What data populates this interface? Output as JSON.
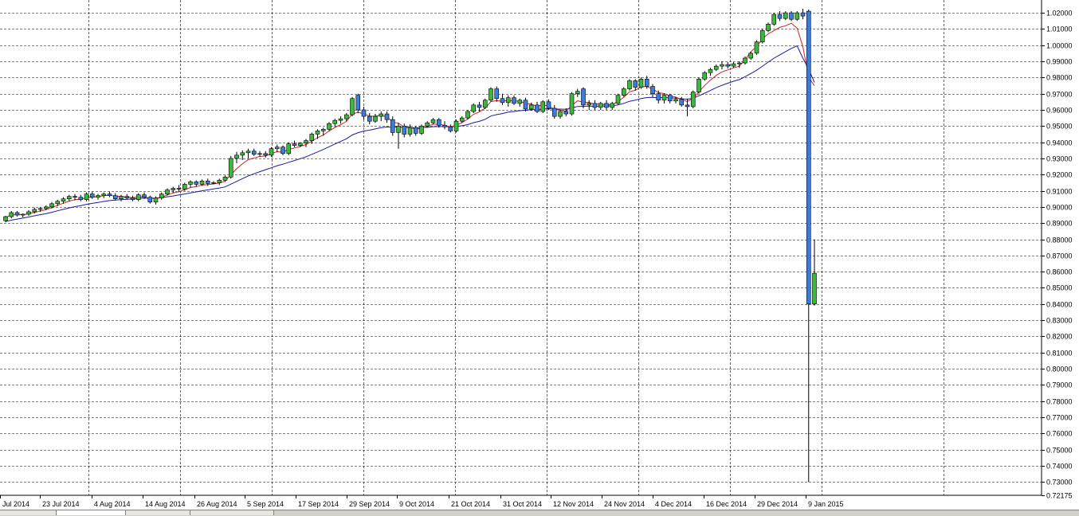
{
  "chart_data": {
    "type": "candlestick",
    "title": "",
    "xlabel": "",
    "ylabel": "",
    "ylim": [
      0.72175,
      1.0225
    ],
    "price_ticks": [
      "1.02000",
      "1.01000",
      "1.00000",
      "0.99000",
      "0.98000",
      "0.97000",
      "0.96000",
      "0.95000",
      "0.94000",
      "0.93000",
      "0.92000",
      "0.91000",
      "0.90000",
      "0.89000",
      "0.88000",
      "0.87000",
      "0.86000",
      "0.85000",
      "0.84000",
      "0.83000",
      "0.82000",
      "0.81000",
      "0.80000",
      "0.79000",
      "0.78000",
      "0.77000",
      "0.76000",
      "0.75000",
      "0.74000",
      "0.73000",
      "0.72175"
    ],
    "x_tick_labels": [
      "Jul 2014",
      "23 Jul 2014",
      "4 Aug 2014",
      "14 Aug 2014",
      "26 Aug 2014",
      "5 Sep 2014",
      "17 Sep 2014",
      "29 Sep 2014",
      "9 Oct 2014",
      "21 Oct 2014",
      "31 Oct 2014",
      "12 Nov 2014",
      "24 Nov 2014",
      "4 Dec 2014",
      "16 Dec 2014",
      "29 Dec 2014",
      "9 Jan 2015"
    ],
    "grid": true,
    "colors": {
      "bull": "#3cb83c",
      "bear": "#3b7ddd",
      "wick": "#000000",
      "ma_fast": "#cc2222",
      "ma_slow": "#1a1aa0",
      "grid": "#000000"
    },
    "ohlc": [
      [
        0.8915,
        0.8945,
        0.8905,
        0.894
      ],
      [
        0.894,
        0.8975,
        0.893,
        0.8965
      ],
      [
        0.8965,
        0.8975,
        0.894,
        0.895
      ],
      [
        0.895,
        0.896,
        0.8935,
        0.8955
      ],
      [
        0.8955,
        0.898,
        0.8945,
        0.897
      ],
      [
        0.897,
        0.8995,
        0.896,
        0.8985
      ],
      [
        0.8985,
        0.9,
        0.897,
        0.899
      ],
      [
        0.899,
        0.901,
        0.898,
        0.9
      ],
      [
        0.9,
        0.903,
        0.899,
        0.902
      ],
      [
        0.902,
        0.9045,
        0.9005,
        0.9035
      ],
      [
        0.9035,
        0.906,
        0.902,
        0.905
      ],
      [
        0.905,
        0.9075,
        0.9035,
        0.9065
      ],
      [
        0.9065,
        0.908,
        0.904,
        0.906
      ],
      [
        0.906,
        0.9075,
        0.9035,
        0.9045
      ],
      [
        0.9045,
        0.909,
        0.9035,
        0.908
      ],
      [
        0.908,
        0.9095,
        0.905,
        0.906
      ],
      [
        0.906,
        0.908,
        0.9045,
        0.907
      ],
      [
        0.907,
        0.909,
        0.9055,
        0.908
      ],
      [
        0.908,
        0.9095,
        0.906,
        0.907
      ],
      [
        0.907,
        0.9085,
        0.904,
        0.905
      ],
      [
        0.905,
        0.9075,
        0.9035,
        0.9065
      ],
      [
        0.9065,
        0.908,
        0.9045,
        0.9055
      ],
      [
        0.9055,
        0.907,
        0.9035,
        0.9045
      ],
      [
        0.9045,
        0.9085,
        0.9035,
        0.9075
      ],
      [
        0.9075,
        0.909,
        0.905,
        0.906
      ],
      [
        0.906,
        0.907,
        0.902,
        0.903
      ],
      [
        0.903,
        0.9065,
        0.9015,
        0.9055
      ],
      [
        0.9055,
        0.909,
        0.9045,
        0.908
      ],
      [
        0.908,
        0.9115,
        0.907,
        0.9105
      ],
      [
        0.9105,
        0.9125,
        0.9085,
        0.9115
      ],
      [
        0.9115,
        0.9135,
        0.9095,
        0.911
      ],
      [
        0.911,
        0.915,
        0.91,
        0.914
      ],
      [
        0.914,
        0.9165,
        0.912,
        0.9155
      ],
      [
        0.9155,
        0.9165,
        0.9125,
        0.914
      ],
      [
        0.914,
        0.917,
        0.913,
        0.916
      ],
      [
        0.916,
        0.9175,
        0.913,
        0.9145
      ],
      [
        0.9145,
        0.916,
        0.914,
        0.915
      ],
      [
        0.915,
        0.9175,
        0.9135,
        0.9165
      ],
      [
        0.9165,
        0.9195,
        0.9155,
        0.9185
      ],
      [
        0.9185,
        0.9315,
        0.9175,
        0.93
      ],
      [
        0.93,
        0.934,
        0.927,
        0.932
      ],
      [
        0.932,
        0.935,
        0.929,
        0.9335
      ],
      [
        0.9335,
        0.936,
        0.93,
        0.9345
      ],
      [
        0.9345,
        0.936,
        0.9315,
        0.9325
      ],
      [
        0.9325,
        0.9345,
        0.931,
        0.933
      ],
      [
        0.933,
        0.9345,
        0.9305,
        0.932
      ],
      [
        0.932,
        0.937,
        0.931,
        0.936
      ],
      [
        0.936,
        0.9385,
        0.934,
        0.937
      ],
      [
        0.937,
        0.938,
        0.932,
        0.933
      ],
      [
        0.933,
        0.94,
        0.932,
        0.939
      ],
      [
        0.939,
        0.941,
        0.937,
        0.938
      ],
      [
        0.938,
        0.94,
        0.937,
        0.9395
      ],
      [
        0.9395,
        0.942,
        0.937,
        0.941
      ],
      [
        0.941,
        0.946,
        0.939,
        0.945
      ],
      [
        0.945,
        0.948,
        0.942,
        0.947
      ],
      [
        0.947,
        0.949,
        0.944,
        0.948
      ],
      [
        0.948,
        0.9525,
        0.947,
        0.9515
      ],
      [
        0.9515,
        0.9545,
        0.9495,
        0.9535
      ],
      [
        0.9535,
        0.956,
        0.9515,
        0.9545
      ],
      [
        0.9545,
        0.958,
        0.953,
        0.957
      ],
      [
        0.957,
        0.968,
        0.956,
        0.967
      ],
      [
        0.969,
        0.97,
        0.958,
        0.96
      ],
      [
        0.96,
        0.962,
        0.954,
        0.956
      ],
      [
        0.956,
        0.958,
        0.951,
        0.953
      ],
      [
        0.953,
        0.9575,
        0.952,
        0.956
      ],
      [
        0.956,
        0.959,
        0.953,
        0.9575
      ],
      [
        0.9575,
        0.959,
        0.952,
        0.954
      ],
      [
        0.954,
        0.956,
        0.944,
        0.946
      ],
      [
        0.946,
        0.952,
        0.936,
        0.95
      ],
      [
        0.95,
        0.9515,
        0.943,
        0.945
      ],
      [
        0.945,
        0.951,
        0.9435,
        0.949
      ],
      [
        0.949,
        0.95,
        0.944,
        0.9455
      ],
      [
        0.9455,
        0.951,
        0.9445,
        0.95
      ],
      [
        0.95,
        0.953,
        0.949,
        0.952
      ],
      [
        0.952,
        0.955,
        0.951,
        0.954
      ],
      [
        0.954,
        0.955,
        0.949,
        0.9505
      ],
      [
        0.9505,
        0.953,
        0.948,
        0.9495
      ],
      [
        0.9495,
        0.951,
        0.946,
        0.947
      ],
      [
        0.947,
        0.954,
        0.946,
        0.953
      ],
      [
        0.953,
        0.956,
        0.952,
        0.955
      ],
      [
        0.955,
        0.96,
        0.954,
        0.959
      ],
      [
        0.959,
        0.964,
        0.958,
        0.963
      ],
      [
        0.963,
        0.965,
        0.959,
        0.9615
      ],
      [
        0.9615,
        0.967,
        0.9605,
        0.966
      ],
      [
        0.966,
        0.974,
        0.965,
        0.973
      ],
      [
        0.973,
        0.9745,
        0.965,
        0.967
      ],
      [
        0.967,
        0.97,
        0.963,
        0.9645
      ],
      [
        0.9645,
        0.969,
        0.962,
        0.9675
      ],
      [
        0.9675,
        0.969,
        0.963,
        0.964
      ],
      [
        0.964,
        0.967,
        0.962,
        0.966
      ],
      [
        0.966,
        0.9675,
        0.959,
        0.9605
      ],
      [
        0.9605,
        0.9645,
        0.9595,
        0.963
      ],
      [
        0.963,
        0.965,
        0.958,
        0.959
      ],
      [
        0.959,
        0.966,
        0.958,
        0.965
      ],
      [
        0.965,
        0.9665,
        0.96,
        0.961
      ],
      [
        0.961,
        0.963,
        0.9545,
        0.956
      ],
      [
        0.956,
        0.96,
        0.9545,
        0.959
      ],
      [
        0.959,
        0.961,
        0.956,
        0.9575
      ],
      [
        0.9575,
        0.971,
        0.9565,
        0.97
      ],
      [
        0.97,
        0.973,
        0.968,
        0.9715
      ],
      [
        0.973,
        0.974,
        0.961,
        0.963
      ],
      [
        0.963,
        0.966,
        0.96,
        0.964
      ],
      [
        0.964,
        0.966,
        0.96,
        0.9615
      ],
      [
        0.9615,
        0.965,
        0.96,
        0.964
      ],
      [
        0.964,
        0.966,
        0.96,
        0.9615
      ],
      [
        0.9615,
        0.965,
        0.96,
        0.964
      ],
      [
        0.964,
        0.97,
        0.963,
        0.969
      ],
      [
        0.969,
        0.974,
        0.968,
        0.973
      ],
      [
        0.973,
        0.979,
        0.972,
        0.978
      ],
      [
        0.978,
        0.979,
        0.972,
        0.974
      ],
      [
        0.974,
        0.98,
        0.973,
        0.979
      ],
      [
        0.979,
        0.981,
        0.973,
        0.9745
      ],
      [
        0.9745,
        0.976,
        0.968,
        0.97
      ],
      [
        0.97,
        0.972,
        0.964,
        0.966
      ],
      [
        0.966,
        0.97,
        0.964,
        0.969
      ],
      [
        0.969,
        0.97,
        0.964,
        0.9655
      ],
      [
        0.9655,
        0.968,
        0.964,
        0.9665
      ],
      [
        0.9665,
        0.968,
        0.962,
        0.963
      ],
      [
        0.963,
        0.967,
        0.956,
        0.962
      ],
      [
        0.962,
        0.972,
        0.961,
        0.971
      ],
      [
        0.971,
        0.98,
        0.97,
        0.979
      ],
      [
        0.979,
        0.984,
        0.978,
        0.983
      ],
      [
        0.983,
        0.986,
        0.981,
        0.985
      ],
      [
        0.985,
        0.988,
        0.984,
        0.987
      ],
      [
        0.987,
        0.99,
        0.985,
        0.988
      ],
      [
        0.988,
        0.9895,
        0.9855,
        0.987
      ],
      [
        0.987,
        0.9895,
        0.986,
        0.9885
      ],
      [
        0.9885,
        0.99,
        0.986,
        0.989
      ],
      [
        0.989,
        0.993,
        0.988,
        0.992
      ],
      [
        0.992,
        0.996,
        0.991,
        0.995
      ],
      [
        0.995,
        1.003,
        0.994,
        1.002
      ],
      [
        1.002,
        1.01,
        1.001,
        1.009
      ],
      [
        1.009,
        1.014,
        1.008,
        1.013
      ],
      [
        1.013,
        1.02,
        1.012,
        1.019
      ],
      [
        1.019,
        1.021,
        1.015,
        1.0165
      ],
      [
        1.0165,
        1.021,
        1.0155,
        1.02
      ],
      [
        1.02,
        1.021,
        1.015,
        1.016
      ],
      [
        1.016,
        1.021,
        1.015,
        1.02
      ],
      [
        1.02,
        1.0225,
        1.016,
        1.018
      ],
      [
        1.021,
        1.022,
        0.73,
        0.84
      ],
      [
        0.84,
        0.88,
        0.839,
        0.859
      ]
    ],
    "ma_fast": [
      0.8935,
      0.895,
      0.8952,
      0.8952,
      0.8958,
      0.8966,
      0.8975,
      0.8983,
      0.8996,
      0.901,
      0.9023,
      0.9036,
      0.9045,
      0.9048,
      0.9058,
      0.906,
      0.9064,
      0.907,
      0.9072,
      0.9066,
      0.9065,
      0.9062,
      0.9057,
      0.9062,
      0.9061,
      0.9052,
      0.9053,
      0.9061,
      0.9074,
      0.9087,
      0.9094,
      0.9107,
      0.912,
      0.9126,
      0.9135,
      0.9138,
      0.9142,
      0.9148,
      0.916,
      0.92,
      0.9236,
      0.9267,
      0.9292,
      0.9303,
      0.9312,
      0.9315,
      0.9329,
      0.9342,
      0.9338,
      0.9356,
      0.9364,
      0.9374,
      0.9386,
      0.9407,
      0.9428,
      0.9445,
      0.9469,
      0.9491,
      0.9509,
      0.9529,
      0.9576,
      0.9584,
      0.9576,
      0.9561,
      0.9561,
      0.9566,
      0.9557,
      0.9525,
      0.9517,
      0.9494,
      0.9493,
      0.948,
      0.9487,
      0.9498,
      0.9512,
      0.951,
      0.9505,
      0.9493,
      0.9506,
      0.9521,
      0.9544,
      0.9573,
      0.9587,
      0.9611,
      0.9651,
      0.9657,
      0.9653,
      0.966,
      0.9653,
      0.9655,
      0.9639,
      0.9636,
      0.9621,
      0.9631,
      0.9624,
      0.9603,
      0.9599,
      0.9591,
      0.9627,
      0.9656,
      0.9647,
      0.9645,
      0.9635,
      0.9637,
      0.963,
      0.9633,
      0.9652,
      0.9678,
      0.9712,
      0.9721,
      0.9744,
      0.9744,
      0.9729,
      0.9706,
      0.9701,
      0.9686,
      0.9679,
      0.9663,
      0.9652,
      0.9671,
      0.9711,
      0.9751,
      0.9784,
      0.9813,
      0.9835,
      0.9847,
      0.986,
      0.987,
      0.991,
      0.996,
      0.999,
      1.004,
      1.007,
      1.009,
      1.011,
      1.012,
      1.0135,
      1.0105,
      0.999,
      0.98,
      0.975
    ],
    "ma_slow": [
      0.891,
      0.8918,
      0.8925,
      0.8931,
      0.8938,
      0.8945,
      0.8952,
      0.8959,
      0.8967,
      0.8976,
      0.8985,
      0.8994,
      0.9002,
      0.9008,
      0.9016,
      0.9022,
      0.9028,
      0.9034,
      0.9039,
      0.9042,
      0.9045,
      0.9047,
      0.9049,
      0.9052,
      0.9054,
      0.9054,
      0.9055,
      0.9058,
      0.9063,
      0.9068,
      0.9074,
      0.908,
      0.9087,
      0.9093,
      0.91,
      0.9105,
      0.9111,
      0.9117,
      0.9124,
      0.9141,
      0.9158,
      0.9175,
      0.9192,
      0.9205,
      0.9218,
      0.923,
      0.9242,
      0.9255,
      0.9264,
      0.9276,
      0.9287,
      0.9298,
      0.931,
      0.9325,
      0.934,
      0.9355,
      0.9372,
      0.9389,
      0.9405,
      0.9421,
      0.9445,
      0.9459,
      0.9469,
      0.9475,
      0.9482,
      0.949,
      0.9494,
      0.9493,
      0.9494,
      0.9491,
      0.9491,
      0.9489,
      0.949,
      0.9492,
      0.9496,
      0.9497,
      0.9497,
      0.9496,
      0.9498,
      0.9502,
      0.9509,
      0.9521,
      0.9529,
      0.9542,
      0.9562,
      0.9571,
      0.9577,
      0.9586,
      0.959,
      0.9595,
      0.9598,
      0.9601,
      0.9601,
      0.9606,
      0.9607,
      0.9605,
      0.9605,
      0.9604,
      0.9612,
      0.9621,
      0.9622,
      0.9623,
      0.9622,
      0.9624,
      0.9624,
      0.9625,
      0.9631,
      0.964,
      0.9653,
      0.966,
      0.967,
      0.9676,
      0.9677,
      0.9675,
      0.9676,
      0.9674,
      0.9673,
      0.9669,
      0.9666,
      0.9672,
      0.9687,
      0.9703,
      0.972,
      0.9737,
      0.9752,
      0.9765,
      0.9777,
      0.9787,
      0.9805,
      0.9825,
      0.9845,
      0.987,
      0.9895,
      0.992,
      0.994,
      0.996,
      0.998,
      0.9995,
      0.992,
      0.985,
      0.977
    ]
  }
}
